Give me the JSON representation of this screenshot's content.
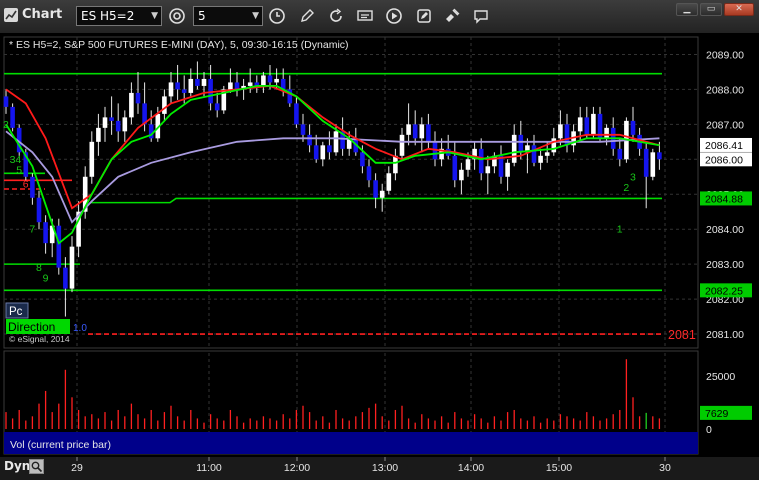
{
  "window": {
    "title": "Chart",
    "symbol": "ES H5=2",
    "interval": "5",
    "controls": [
      "minimize",
      "maximize",
      "close"
    ]
  },
  "icons": [
    "chart-icon",
    "link-icon",
    "clock-icon",
    "pencil-icon",
    "refresh-icon",
    "quote-icon",
    "play-icon",
    "edit-icon",
    "satellite-icon",
    "comment-icon"
  ],
  "header_text": "* ES H5=2, S&P 500 FUTURES E-MINI (DAY), 5, 09:30-16:15 (Dynamic)",
  "badges": {
    "pc": "Pc",
    "direction": "Direction",
    "direction_suffix": "1.0"
  },
  "copyright": "© eSignal, 2014",
  "volume_label": "Vol (current price bar)",
  "dyn_label": "Dyn",
  "colors": {
    "up_candle": "#ffffff",
    "down_candle": "#1515ee",
    "fast_ma": "#00ee00",
    "red_ma": "#ff1a1a",
    "purple_ma": "#a99be0",
    "green_line": "#00dd00",
    "red_dashed": "#ff2020",
    "volume_bar": "#ff2020"
  },
  "chart_data": {
    "type": "line",
    "x_axis_labels": [
      "29",
      "11:00",
      "12:00",
      "13:00",
      "14:00",
      "15:00",
      "30"
    ],
    "price_axis": {
      "ticks": [
        "2089.00",
        "2088.00",
        "2087.00",
        "2086.00",
        "2085.00",
        "2084.00",
        "2083.00",
        "2082.00",
        "2081.00"
      ],
      "range": [
        2080.6,
        2089.5
      ],
      "markers": [
        {
          "label": "2086.41",
          "value": 2086.41,
          "style": "white"
        },
        {
          "label": "2086.00",
          "value": 2086.0,
          "style": "white"
        },
        {
          "label": "2084.88",
          "value": 2084.88,
          "style": "green"
        },
        {
          "label": "2082.25",
          "value": 2082.25,
          "style": "green"
        },
        {
          "label": "2081",
          "value": 2081.0,
          "style": "red"
        }
      ]
    },
    "levels": [
      {
        "value": 2088.45,
        "style": "green-solid"
      },
      {
        "value": 2084.88,
        "style": "green-step"
      },
      {
        "value": 2082.25,
        "style": "green-solid"
      },
      {
        "value": 2081.0,
        "style": "red-dashed"
      }
    ],
    "candles": [
      [
        2087.8,
        2088.0,
        2087.3,
        2087.5
      ],
      [
        2087.5,
        2087.6,
        2086.8,
        2086.9
      ],
      [
        2086.9,
        2087.0,
        2086.1,
        2086.2
      ],
      [
        2086.2,
        2086.3,
        2085.4,
        2085.5
      ],
      [
        2085.5,
        2085.6,
        2084.7,
        2084.9
      ],
      [
        2084.9,
        2085.1,
        2084.0,
        2084.2
      ],
      [
        2084.2,
        2084.4,
        2083.3,
        2083.6
      ],
      [
        2083.6,
        2084.3,
        2083.2,
        2084.1
      ],
      [
        2084.1,
        2084.3,
        2082.7,
        2082.9
      ],
      [
        2082.9,
        2083.2,
        2081.5,
        2082.3
      ],
      [
        2082.3,
        2083.8,
        2082.2,
        2083.5
      ],
      [
        2083.5,
        2084.8,
        2083.2,
        2084.5
      ],
      [
        2084.5,
        2085.8,
        2084.3,
        2085.5
      ],
      [
        2085.5,
        2086.8,
        2085.3,
        2086.5
      ],
      [
        2086.5,
        2087.3,
        2086.1,
        2086.9
      ],
      [
        2086.9,
        2087.5,
        2086.5,
        2087.2
      ],
      [
        2087.2,
        2087.8,
        2086.7,
        2087.1
      ],
      [
        2087.1,
        2087.6,
        2086.5,
        2086.8
      ],
      [
        2086.8,
        2087.4,
        2086.5,
        2087.2
      ],
      [
        2087.2,
        2088.2,
        2087.0,
        2087.9
      ],
      [
        2087.9,
        2088.5,
        2087.3,
        2087.6
      ],
      [
        2087.6,
        2088.2,
        2086.8,
        2087.0
      ],
      [
        2087.0,
        2087.4,
        2086.5,
        2086.6
      ],
      [
        2086.6,
        2087.5,
        2086.5,
        2087.3
      ],
      [
        2087.3,
        2088.0,
        2087.1,
        2087.8
      ],
      [
        2087.8,
        2088.5,
        2087.6,
        2088.2
      ],
      [
        2088.2,
        2088.7,
        2087.7,
        2088.0
      ],
      [
        2088.0,
        2088.4,
        2087.6,
        2087.9
      ],
      [
        2087.9,
        2088.6,
        2087.8,
        2088.3
      ],
      [
        2088.3,
        2088.8,
        2088.0,
        2088.1
      ],
      [
        2088.1,
        2088.5,
        2087.8,
        2088.3
      ],
      [
        2088.3,
        2088.7,
        2087.4,
        2087.6
      ],
      [
        2087.6,
        2087.9,
        2087.2,
        2087.4
      ],
      [
        2087.4,
        2088.1,
        2087.3,
        2088.0
      ],
      [
        2088.0,
        2088.6,
        2087.9,
        2088.2
      ],
      [
        2088.2,
        2088.5,
        2087.8,
        2088.0
      ],
      [
        2088.0,
        2088.3,
        2087.7,
        2088.1
      ],
      [
        2088.1,
        2088.6,
        2087.9,
        2088.2
      ],
      [
        2088.2,
        2088.4,
        2087.9,
        2088.1
      ],
      [
        2088.1,
        2088.5,
        2087.9,
        2088.4
      ],
      [
        2088.4,
        2088.7,
        2088.0,
        2088.2
      ],
      [
        2088.2,
        2088.6,
        2088.0,
        2088.3
      ],
      [
        2088.3,
        2088.6,
        2087.8,
        2088.0
      ],
      [
        2088.0,
        2088.4,
        2087.5,
        2087.6
      ],
      [
        2087.6,
        2087.8,
        2086.9,
        2087.0
      ],
      [
        2087.0,
        2087.3,
        2086.5,
        2086.7
      ],
      [
        2086.7,
        2087.0,
        2086.2,
        2086.4
      ],
      [
        2086.4,
        2086.7,
        2085.9,
        2086.0
      ],
      [
        2086.0,
        2086.5,
        2085.8,
        2086.4
      ],
      [
        2086.4,
        2086.8,
        2086.0,
        2086.2
      ],
      [
        2086.2,
        2087.0,
        2086.1,
        2086.8
      ],
      [
        2086.8,
        2087.2,
        2086.1,
        2086.3
      ],
      [
        2086.3,
        2086.8,
        2086.1,
        2086.6
      ],
      [
        2086.6,
        2086.9,
        2086.1,
        2086.2
      ],
      [
        2086.2,
        2086.4,
        2085.6,
        2085.8
      ],
      [
        2085.8,
        2086.0,
        2085.2,
        2085.4
      ],
      [
        2085.4,
        2085.6,
        2084.6,
        2084.9
      ],
      [
        2084.9,
        2085.3,
        2084.5,
        2085.1
      ],
      [
        2085.1,
        2085.8,
        2085.0,
        2085.6
      ],
      [
        2085.6,
        2086.3,
        2085.4,
        2086.1
      ],
      [
        2086.1,
        2086.9,
        2086.0,
        2086.7
      ],
      [
        2086.7,
        2087.6,
        2086.4,
        2087.0
      ],
      [
        2087.0,
        2087.4,
        2086.4,
        2086.6
      ],
      [
        2086.6,
        2087.2,
        2086.2,
        2087.0
      ],
      [
        2087.0,
        2087.3,
        2086.3,
        2086.5
      ],
      [
        2086.5,
        2086.8,
        2085.8,
        2086.0
      ],
      [
        2086.0,
        2086.6,
        2085.8,
        2086.3
      ],
      [
        2086.3,
        2086.7,
        2086.0,
        2086.1
      ],
      [
        2086.1,
        2086.5,
        2085.2,
        2085.4
      ],
      [
        2085.4,
        2085.9,
        2085.0,
        2085.7
      ],
      [
        2085.7,
        2086.2,
        2085.5,
        2086.0
      ],
      [
        2086.0,
        2086.5,
        2085.7,
        2086.3
      ],
      [
        2086.3,
        2086.6,
        2085.4,
        2085.6
      ],
      [
        2085.6,
        2086.1,
        2085.0,
        2085.8
      ],
      [
        2085.8,
        2086.2,
        2085.6,
        2086.1
      ],
      [
        2086.1,
        2086.4,
        2085.3,
        2085.5
      ],
      [
        2085.5,
        2086.0,
        2085.1,
        2085.9
      ],
      [
        2085.9,
        2087.0,
        2085.8,
        2086.7
      ],
      [
        2086.7,
        2087.1,
        2086.0,
        2086.2
      ],
      [
        2086.2,
        2086.6,
        2085.6,
        2086.4
      ],
      [
        2086.4,
        2086.7,
        2085.8,
        2085.9
      ],
      [
        2085.9,
        2086.3,
        2085.7,
        2086.1
      ],
      [
        2086.1,
        2086.5,
        2085.9,
        2086.2
      ],
      [
        2086.2,
        2086.9,
        2086.1,
        2086.6
      ],
      [
        2086.6,
        2087.4,
        2086.4,
        2087.0
      ],
      [
        2087.0,
        2087.3,
        2086.2,
        2086.4
      ],
      [
        2086.4,
        2087.0,
        2086.2,
        2086.8
      ],
      [
        2086.8,
        2087.5,
        2086.5,
        2087.2
      ],
      [
        2087.2,
        2087.5,
        2086.6,
        2086.7
      ],
      [
        2086.7,
        2087.5,
        2086.6,
        2087.3
      ],
      [
        2087.3,
        2087.5,
        2086.5,
        2086.6
      ],
      [
        2086.6,
        2087.0,
        2086.4,
        2086.9
      ],
      [
        2086.9,
        2087.2,
        2086.1,
        2086.3
      ],
      [
        2086.3,
        2086.6,
        2085.8,
        2086.0
      ],
      [
        2086.0,
        2087.2,
        2085.9,
        2087.1
      ],
      [
        2087.1,
        2087.5,
        2086.5,
        2086.7
      ],
      [
        2086.7,
        2086.9,
        2086.1,
        2086.3
      ],
      [
        2086.3,
        2086.5,
        2084.6,
        2085.5
      ],
      [
        2085.5,
        2086.3,
        2085.4,
        2086.2
      ],
      [
        2086.2,
        2086.5,
        2085.7,
        2086.0
      ]
    ],
    "fast_ma": [
      [
        0,
        2087.0
      ],
      [
        4,
        2085.8
      ],
      [
        8,
        2083.6
      ],
      [
        10,
        2083.9
      ],
      [
        13,
        2085.0
      ],
      [
        16,
        2086.0
      ],
      [
        19,
        2086.5
      ],
      [
        22,
        2086.7
      ],
      [
        25,
        2087.3
      ],
      [
        28,
        2087.7
      ],
      [
        33,
        2087.9
      ],
      [
        38,
        2088.1
      ],
      [
        41,
        2088.1
      ],
      [
        44,
        2087.8
      ],
      [
        48,
        2087.1
      ],
      [
        52,
        2086.6
      ],
      [
        56,
        2085.9
      ],
      [
        59,
        2085.9
      ],
      [
        62,
        2086.1
      ],
      [
        67,
        2086.2
      ],
      [
        72,
        2086.0
      ],
      [
        77,
        2086.2
      ],
      [
        83,
        2086.3
      ],
      [
        88,
        2086.6
      ],
      [
        93,
        2086.6
      ],
      [
        99,
        2086.4
      ]
    ],
    "red_ma": [
      [
        0,
        2088.0
      ],
      [
        3,
        2087.6
      ],
      [
        6,
        2086.6
      ],
      [
        8,
        2085.6
      ],
      [
        10,
        2084.6
      ],
      [
        13,
        2085.0
      ],
      [
        16,
        2086.0
      ],
      [
        20,
        2086.9
      ],
      [
        25,
        2087.6
      ],
      [
        30,
        2087.9
      ],
      [
        35,
        2088.0
      ],
      [
        40,
        2088.1
      ],
      [
        44,
        2087.8
      ],
      [
        48,
        2087.2
      ],
      [
        52,
        2086.7
      ],
      [
        56,
        2086.3
      ],
      [
        60,
        2086.0
      ],
      [
        64,
        2086.3
      ],
      [
        68,
        2086.2
      ],
      [
        73,
        2086.0
      ],
      [
        78,
        2086.1
      ],
      [
        83,
        2086.5
      ],
      [
        88,
        2086.7
      ],
      [
        93,
        2086.7
      ],
      [
        99,
        2086.4
      ]
    ],
    "purple_ma": [
      [
        0,
        2086.8
      ],
      [
        4,
        2086.2
      ],
      [
        7,
        2085.5
      ],
      [
        10,
        2084.2
      ],
      [
        13,
        2084.8
      ],
      [
        17,
        2085.5
      ],
      [
        22,
        2085.9
      ],
      [
        28,
        2086.2
      ],
      [
        35,
        2086.5
      ],
      [
        42,
        2086.6
      ],
      [
        50,
        2086.6
      ],
      [
        60,
        2086.5
      ],
      [
        70,
        2086.5
      ],
      [
        80,
        2086.5
      ],
      [
        90,
        2086.5
      ],
      [
        99,
        2086.6
      ]
    ],
    "count_labels": [
      {
        "text": "2",
        "color": "green",
        "value": 2086.9,
        "bar": 0
      },
      {
        "text": "34",
        "color": "green",
        "value": 2085.9,
        "bar": 1
      },
      {
        "text": "5",
        "color": "green",
        "value": 2085.6,
        "bar": 2
      },
      {
        "text": "6",
        "color": "red",
        "value": 2085.2,
        "bar": 3
      },
      {
        "text": "7",
        "color": "green",
        "value": 2083.9,
        "bar": 4
      },
      {
        "text": "8",
        "color": "green",
        "value": 2082.8,
        "bar": 5
      },
      {
        "text": "9",
        "color": "green",
        "value": 2082.5,
        "bar": 6
      },
      {
        "text": "2",
        "color": "green",
        "value": 2085.1,
        "bar": 94
      },
      {
        "text": "3",
        "color": "green",
        "value": 2085.4,
        "bar": 95
      },
      {
        "text": "1",
        "color": "green",
        "value": 2083.9,
        "bar": 93
      }
    ],
    "volume": {
      "axis_ticks": [
        "25000",
        "0"
      ],
      "marker": "7629",
      "range": [
        0,
        35000
      ],
      "values": [
        8000,
        5000,
        9000,
        4000,
        6000,
        12000,
        18000,
        8000,
        12000,
        28000,
        15000,
        9000,
        6000,
        7000,
        5000,
        8000,
        4000,
        9000,
        6000,
        12000,
        7000,
        5000,
        9000,
        4000,
        8000,
        11000,
        6000,
        4000,
        9000,
        5000,
        3000,
        7000,
        5000,
        4000,
        9000,
        6000,
        3000,
        5000,
        4000,
        6000,
        5000,
        4000,
        7000,
        5000,
        9000,
        11000,
        8000,
        4000,
        6000,
        3000,
        9000,
        5000,
        4000,
        6000,
        8000,
        10000,
        12000,
        6000,
        4000,
        9000,
        11000,
        5000,
        3000,
        7000,
        5000,
        4000,
        6000,
        3000,
        8000,
        5000,
        4000,
        7000,
        5000,
        3000,
        6000,
        4000,
        8000,
        9000,
        5000,
        4000,
        6000,
        3000,
        5000,
        4000,
        7000,
        6000,
        5000,
        4000,
        8000,
        6000,
        4000,
        5000,
        7000,
        9000,
        33000,
        15000,
        6000,
        7629,
        6000,
        5000
      ]
    }
  }
}
